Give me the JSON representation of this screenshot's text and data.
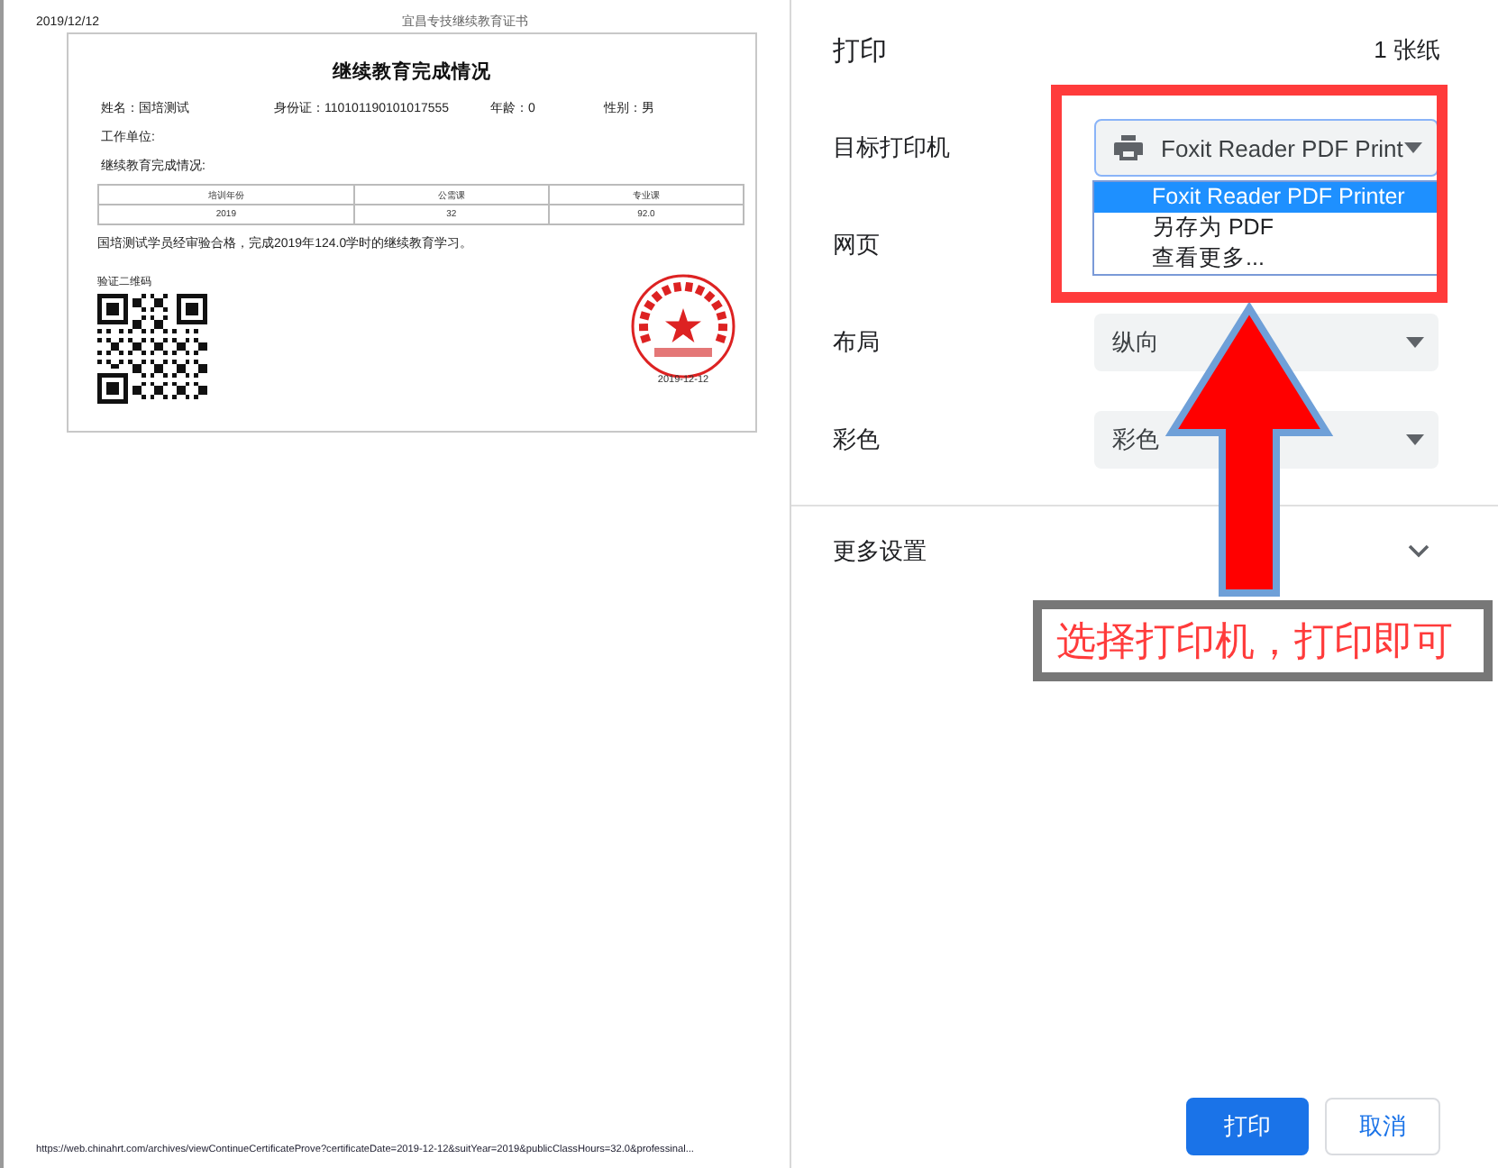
{
  "preview": {
    "header_date": "2019/12/12",
    "header_title": "宜昌专技继续教育证书",
    "certificate": {
      "title": "继续教育完成情况",
      "fields": [
        "姓名：国培测试",
        "身份证：110101190101017555",
        "年龄：0",
        "性别：男"
      ],
      "work_unit_label": "工作单位:",
      "section_label": "继续教育完成情况:",
      "table": {
        "columns": [
          "培训年份",
          "公需课",
          "专业课"
        ],
        "rows": [
          [
            "2019",
            "32",
            "92.0"
          ]
        ]
      },
      "statement": "国培测试学员经审验合格，完成2019年124.0学时的继续教育学习。",
      "qr_label": "验证二维码",
      "seal_date": "2019-12-12"
    },
    "footer_url": "https://web.chinahrt.com/archives/viewContinueCertificateProve?certificateDate=2019-12-12&suitYear=2019&publicClassHours=32.0&professinal..."
  },
  "panel": {
    "title": "打印",
    "sheet_count": "1 张纸",
    "settings": [
      {
        "label": "目标打印机",
        "kind": "printer",
        "value": "Foxit Reader PDF Print"
      },
      {
        "label": "网页",
        "kind": "covered"
      },
      {
        "label": "布局",
        "kind": "select",
        "value": "纵向"
      },
      {
        "label": "彩色",
        "kind": "select",
        "value": "彩色"
      }
    ],
    "dropdown": {
      "options": [
        {
          "label": "Foxit Reader PDF Printer",
          "selected": true
        },
        {
          "label": "另存为 PDF",
          "selected": false
        },
        {
          "label": "查看更多...",
          "selected": false
        }
      ]
    },
    "more_settings": "更多设置",
    "buttons": [
      {
        "label": "打印",
        "kind": "primary"
      },
      {
        "label": "取消",
        "kind": "secondary"
      }
    ]
  },
  "annotation": {
    "callout": "选择打印机，打印即可"
  }
}
